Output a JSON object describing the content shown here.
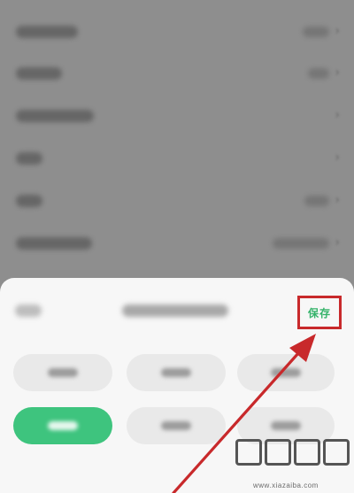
{
  "settings_rows": [
    {
      "label": "",
      "value": ""
    },
    {
      "label": "",
      "value": ""
    },
    {
      "label": "",
      "value": ""
    },
    {
      "label": "",
      "value": ""
    },
    {
      "label": "",
      "value": ""
    },
    {
      "label": "",
      "value": ""
    }
  ],
  "sheet": {
    "cancel_label": "",
    "title": "",
    "save_label": "保存",
    "options": [
      {
        "label": "",
        "selected": false
      },
      {
        "label": "",
        "selected": false
      },
      {
        "label": "",
        "selected": false
      },
      {
        "label": "",
        "selected": true
      },
      {
        "label": "",
        "selected": false
      },
      {
        "label": "",
        "selected": false
      }
    ]
  },
  "watermark": {
    "url": "www.xiazaiba.com"
  },
  "colors": {
    "accent": "#35b36a",
    "selected_chip": "#3ec47e",
    "annotation": "#c8292b",
    "overlay": "#8e8e8e"
  },
  "icons": [
    "chevron-right-icon",
    "annotation-arrow-icon",
    "watermark-logo-icon"
  ]
}
